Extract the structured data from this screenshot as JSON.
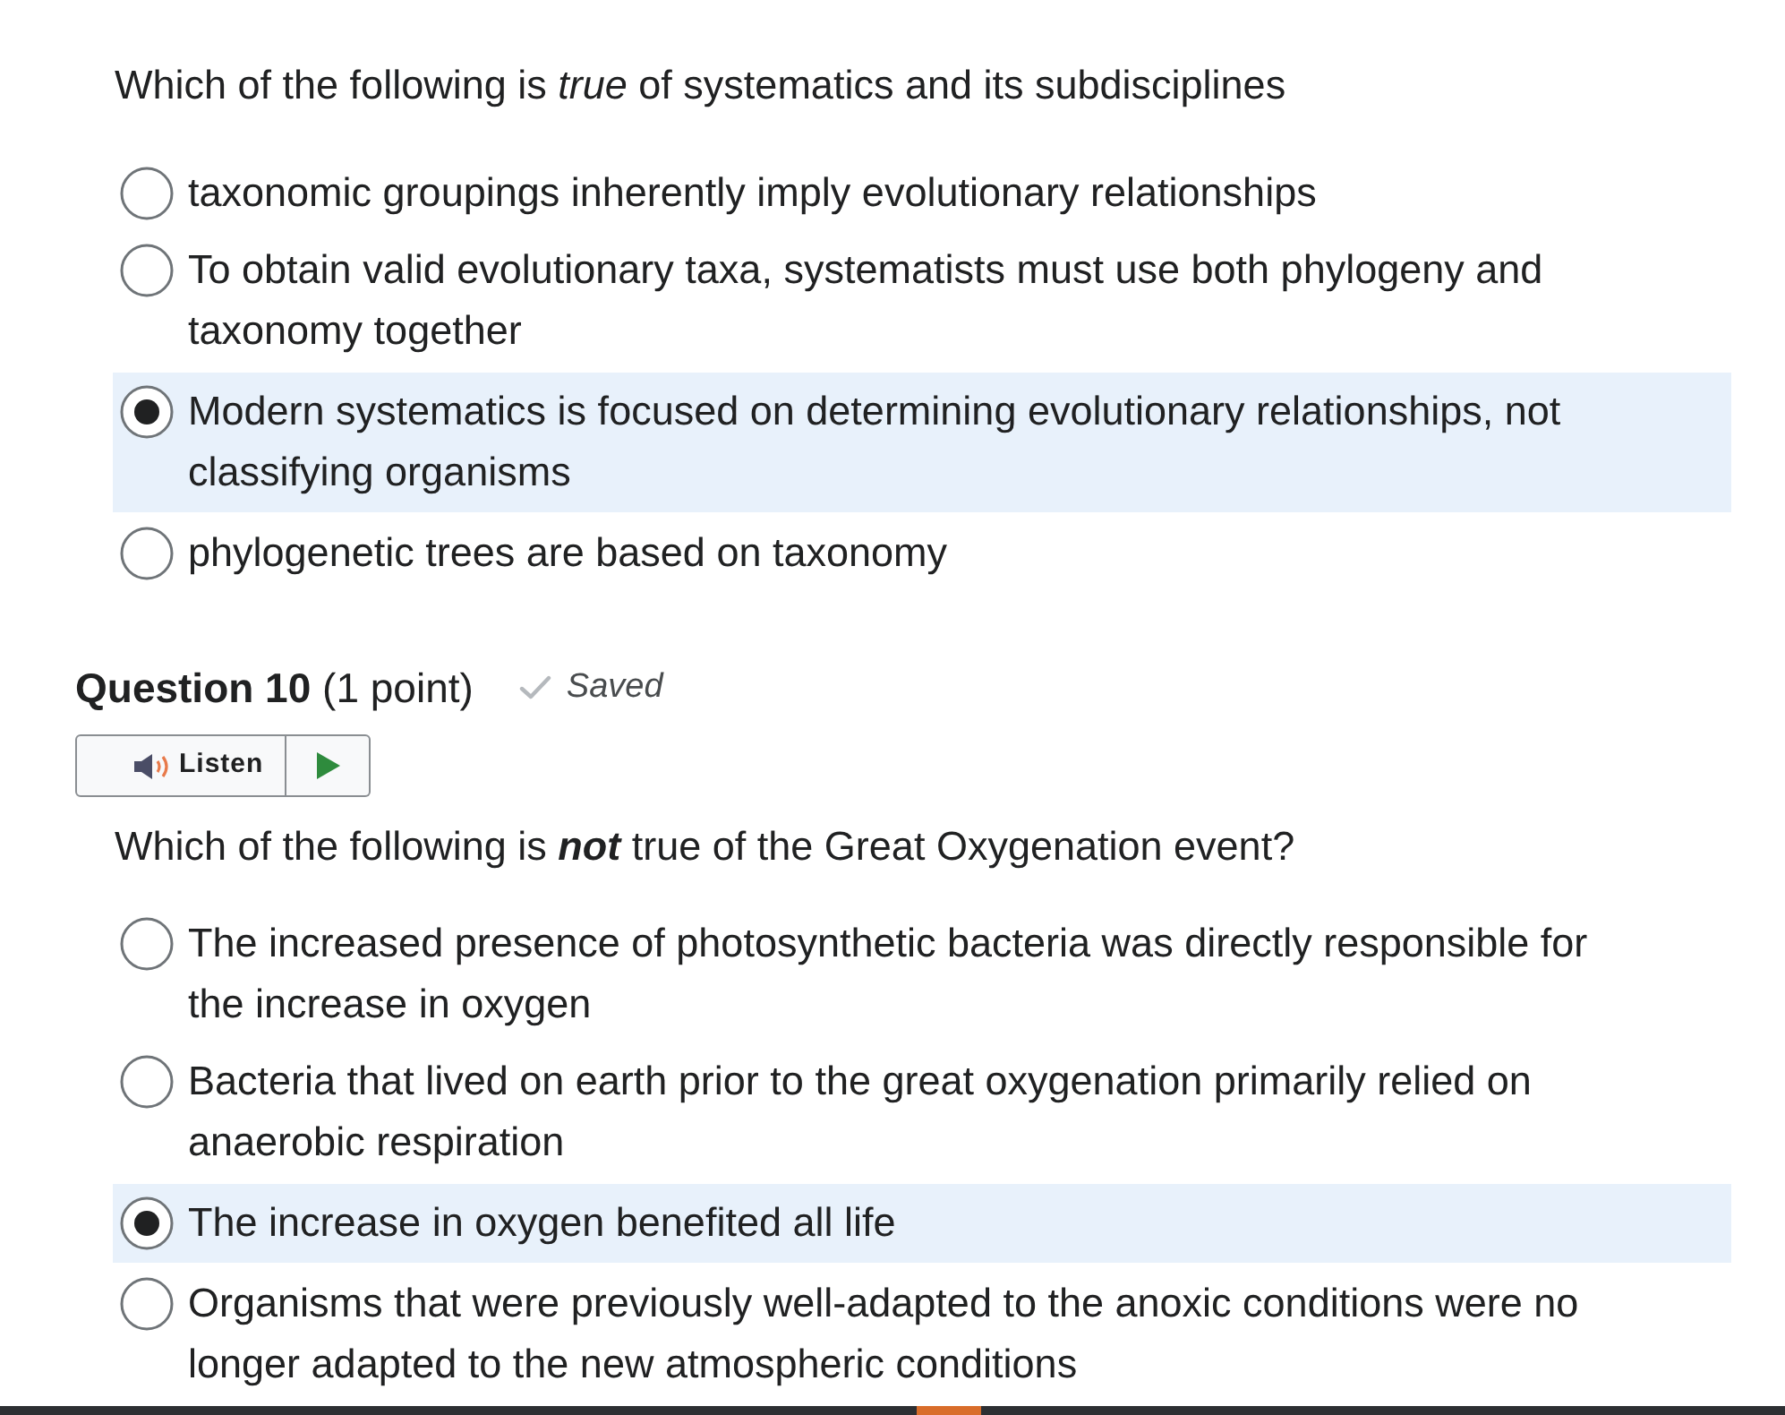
{
  "questions": [
    {
      "prompt": [
        {
          "text": "Which of the following is "
        },
        {
          "text": "true",
          "italic": true
        },
        {
          "text": " of systematics and its subdisciplines"
        }
      ],
      "options": [
        {
          "text": "taxonomic groupings inherently imply evolutionary relationships",
          "selected": false
        },
        {
          "text": "To obtain valid evolutionary taxa, systematists must use both phylogeny and taxonomy together",
          "selected": false
        },
        {
          "text": "Modern systematics is focused on determining evolutionary relationships, not classifying organisms",
          "selected": true
        },
        {
          "text": "phylogenetic trees are based on taxonomy",
          "selected": false
        }
      ]
    },
    {
      "heading": "Question 10",
      "points": "(1 point)",
      "status": "Saved",
      "listen": {
        "label": "Listen"
      },
      "prompt": [
        {
          "text": "Which of the following is "
        },
        {
          "text": "not",
          "bold": true,
          "italic": true
        },
        {
          "text": " true of the Great Oxygenation event?"
        }
      ],
      "options": [
        {
          "text": "The increased presence of photosynthetic bacteria was directly responsible for the increase in oxygen",
          "selected": false
        },
        {
          "text": "Bacteria that lived on earth prior to the great oxygenation primarily relied on anaerobic respiration",
          "selected": false
        },
        {
          "text": "The increase in oxygen benefited all life",
          "selected": true
        },
        {
          "text": "Organisms that were previously well-adapted to the anoxic conditions were no longer adapted to the new atmospheric conditions",
          "selected": false
        }
      ]
    }
  ]
}
